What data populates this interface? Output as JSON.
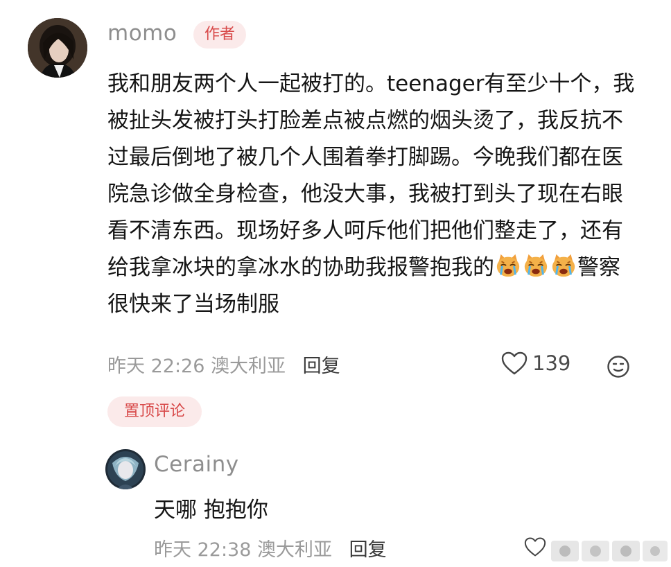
{
  "main_comment": {
    "author": "momo",
    "author_badge": "作者",
    "text_part1": "我和朋友两个人一起被打的。teenager有至少十个，我被扯头发被打头打脸差点被点燃的烟头烫了，我反抗不过最后倒地了被几个人围着拳打脚踢。今晚我们都在医院急诊做全身检查，他没大事，我被打到头了现在右眼看不清东西。现场好多人呵斥他们把他们整走了，还有给我拿冰块的拿冰水的协助我报警抱我的",
    "text_part2": "警察很快来了当场制服",
    "emoji_name": "crying-cat-emoji",
    "date": "昨天",
    "time": "22:26",
    "location": "澳大利亚",
    "reply_label": "回复",
    "like_count": "139",
    "icons": [
      "heart-outline-icon",
      "emoji-react-icon"
    ]
  },
  "pinned_label": "置顶评论",
  "reply_comment": {
    "author": "Cerainy",
    "text": "天哪 抱抱你",
    "date": "昨天",
    "time": "22:38",
    "location": "澳大利亚",
    "reply_label": "回复"
  },
  "colors": {
    "badge_bg": "#fbeaea",
    "badge_text": "#d84a4a",
    "text": "#151515",
    "meta": "#9a9a9a"
  }
}
